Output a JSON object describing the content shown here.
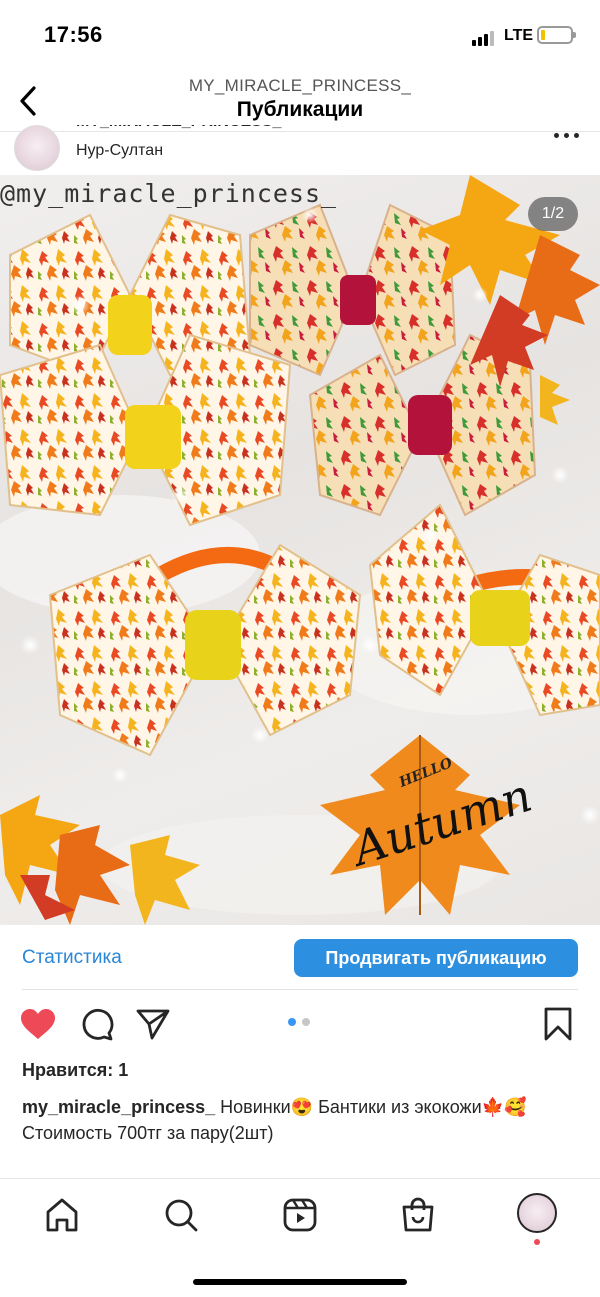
{
  "status_bar": {
    "time": "17:56",
    "network": "LTE"
  },
  "header": {
    "username": "MY_MIRACLE_PRINCESS_",
    "title": "Публикации"
  },
  "post": {
    "location": "Нур-Султан",
    "image": {
      "watermark": "@my_miracle_princess_",
      "counter": "1/2",
      "sticker_small": "HELLO",
      "sticker_large": "Autumn"
    },
    "stats_label": "Статистика",
    "promote_label": "Продвигать публикацию",
    "likes": "Нравится: 1",
    "caption": {
      "username": "my_miracle_princess_",
      "text": "Новинки😍 Бантики из экокожи🍁🥰Стоимость 700тг за пару(2шт)"
    },
    "carousel": {
      "current": 1,
      "total": 2
    }
  },
  "tab_bar": {
    "items": [
      "home-icon",
      "search-icon",
      "reels-icon",
      "shop-icon",
      "profile-avatar"
    ]
  },
  "colors": {
    "accent": "#2d8fe0",
    "like": "#ed4956",
    "autumn_orange": "#f08a1c",
    "autumn_red": "#d23b24",
    "ribbon_yellow": "#f2d21a",
    "ribbon_crimson": "#b3123b"
  }
}
